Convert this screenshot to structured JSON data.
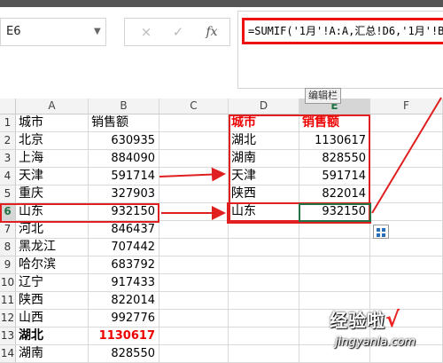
{
  "namebox": {
    "value": "E6"
  },
  "formula_bar": {
    "cancel_icon": "×",
    "enter_icon": "✓",
    "fx_label": "fx",
    "formula": "=SUMIF('1月'!A:A,汇总!D6,'1月'!B:",
    "tooltip": "编辑栏"
  },
  "columns": [
    "A",
    "B",
    "C",
    "D",
    "E",
    "F"
  ],
  "rows": [
    {
      "n": "1",
      "a": "城市",
      "b": "销售额",
      "d": "城市",
      "e": "销售额"
    },
    {
      "n": "2",
      "a": "北京",
      "b": "630935",
      "d": "湖北",
      "e": "1130617"
    },
    {
      "n": "3",
      "a": "上海",
      "b": "884090",
      "d": "湖南",
      "e": "828550"
    },
    {
      "n": "4",
      "a": "天津",
      "b": "591714",
      "d": "天津",
      "e": "591714"
    },
    {
      "n": "5",
      "a": "重庆",
      "b": "327903",
      "d": "陕西",
      "e": "822014"
    },
    {
      "n": "6",
      "a": "山东",
      "b": "932150",
      "d": "山东",
      "e": "932150"
    },
    {
      "n": "7",
      "a": "河北",
      "b": "846437",
      "d": "",
      "e": ""
    },
    {
      "n": "8",
      "a": "黑龙江",
      "b": "707442",
      "d": "",
      "e": ""
    },
    {
      "n": "9",
      "a": "哈尔滨",
      "b": "683792",
      "d": "",
      "e": ""
    },
    {
      "n": "10",
      "a": "辽宁",
      "b": "917433",
      "d": "",
      "e": ""
    },
    {
      "n": "11",
      "a": "陕西",
      "b": "822014",
      "d": "",
      "e": ""
    },
    {
      "n": "12",
      "a": "山西",
      "b": "992776",
      "d": "",
      "e": ""
    },
    {
      "n": "13",
      "a": "湖北",
      "b": "1130617",
      "d": "",
      "e": ""
    },
    {
      "n": "14",
      "a": "湖南",
      "b": "828550",
      "d": "",
      "e": ""
    }
  ],
  "watermark": {
    "title": "经验啦",
    "check": "√",
    "url": "jingyanla.com"
  },
  "colors": {
    "highlight_red": "#e02020",
    "excel_green": "#217346",
    "header_red": "#e00000"
  }
}
